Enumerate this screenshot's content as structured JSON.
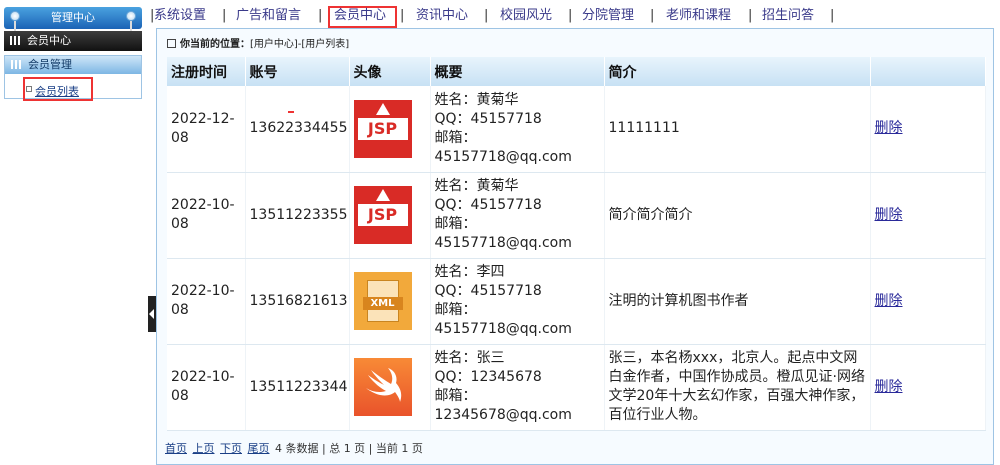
{
  "sidebar": {
    "header": "管理中心",
    "section": "会员中心",
    "group_title": "会员管理",
    "link": "会员列表"
  },
  "topnav": {
    "items": [
      "系统设置",
      "广告和留言",
      "会员中心",
      "资讯中心",
      "校园风光",
      "分院管理",
      "老师和课程",
      "招生问答"
    ],
    "separator": "|",
    "active": "会员中心"
  },
  "breadcrumb": {
    "label": "你当前的位置：",
    "path": "[用户中心]-[用户列表]"
  },
  "table": {
    "headers": [
      "注册时间",
      "账号",
      "头像",
      "概要",
      "简介",
      ""
    ],
    "rows": [
      {
        "date": "2022-12-08",
        "account": "13622334455",
        "avatar": "jsp-icon",
        "name": "姓名：黄菊华",
        "qq": "QQ：45157718",
        "email_label": "邮箱：",
        "email": "45157718@qq.com",
        "intro": "11111111",
        "action": "删除"
      },
      {
        "date": "2022-10-08",
        "account": "13511223355",
        "avatar": "jsp-icon",
        "name": "姓名：黄菊华",
        "qq": "QQ：45157718",
        "email_label": "邮箱：",
        "email": "45157718@qq.com",
        "intro": "简介简介简介",
        "action": "删除"
      },
      {
        "date": "2022-10-08",
        "account": "13516821613",
        "avatar": "xml-icon",
        "name": "姓名：李四",
        "qq": "QQ：45157718",
        "email_label": "邮箱：",
        "email": "45157718@qq.com",
        "intro": "注明的计算机图书作者",
        "action": "删除"
      },
      {
        "date": "2022-10-08",
        "account": "13511223344",
        "avatar": "swift-icon",
        "name": "姓名：张三",
        "qq": "QQ：12345678",
        "email_label": "邮箱：",
        "email": "12345678@qq.com",
        "intro": "张三，本名杨xxx，北京人。起点中文网白金作者，中国作协成员。橙瓜见证·网络文学20年十大玄幻作家，百强大神作家，百位行业人物。",
        "action": "删除"
      }
    ]
  },
  "pager": {
    "first": "首页",
    "prev": "上页",
    "next": "下页",
    "last": "尾页",
    "info": "4 条数据 | 总 1 页 | 当前 1 页"
  },
  "colors": {
    "highlight_box": "#ee3333",
    "header_gradient_top": "#4aa2e0",
    "link": "#1a3f86"
  }
}
